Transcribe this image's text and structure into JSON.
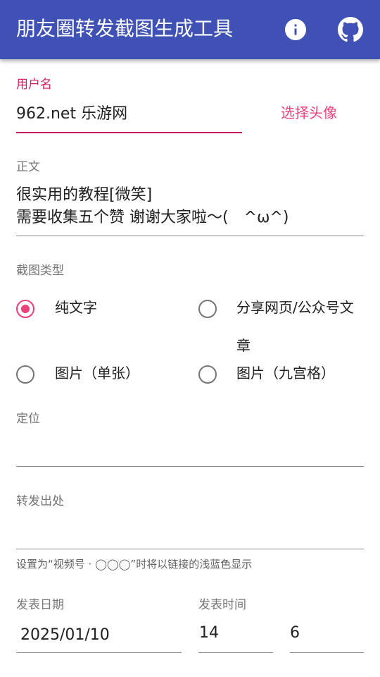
{
  "appbar": {
    "title": "朋友圈转发截图生成工具",
    "info_icon": "info-icon",
    "github_icon": "github-icon"
  },
  "username": {
    "label": "用户名",
    "value": "962.net 乐游网",
    "choose_avatar": "选择头像"
  },
  "content": {
    "label": "正文",
    "line1": "很实用的教程[微笑]",
    "line2": "需要收集五个赞 谢谢大家啦～(　^ω^)"
  },
  "screenshot_type": {
    "label": "截图类型",
    "options": [
      {
        "label": "纯文字",
        "checked": true
      },
      {
        "label": "分享网页/公众号文章",
        "checked": false
      },
      {
        "label": "图片（单张）",
        "checked": false
      },
      {
        "label": "图片（九宫格）",
        "checked": false
      }
    ]
  },
  "location": {
    "label": "定位",
    "value": ""
  },
  "forward_source": {
    "label": "转发出处",
    "value": "",
    "hint": "设置为“视频号 · ◯◯◯”时将以链接的浅蓝色显示"
  },
  "publish": {
    "date_label": "发表日期",
    "date_value": "2025/01/10",
    "time_label": "发表时间",
    "hour_value": "14",
    "minute_value": "6"
  },
  "colors": {
    "primary": "#3f51b5",
    "accent": "#ec407a",
    "active_underline": "#c2185b"
  }
}
